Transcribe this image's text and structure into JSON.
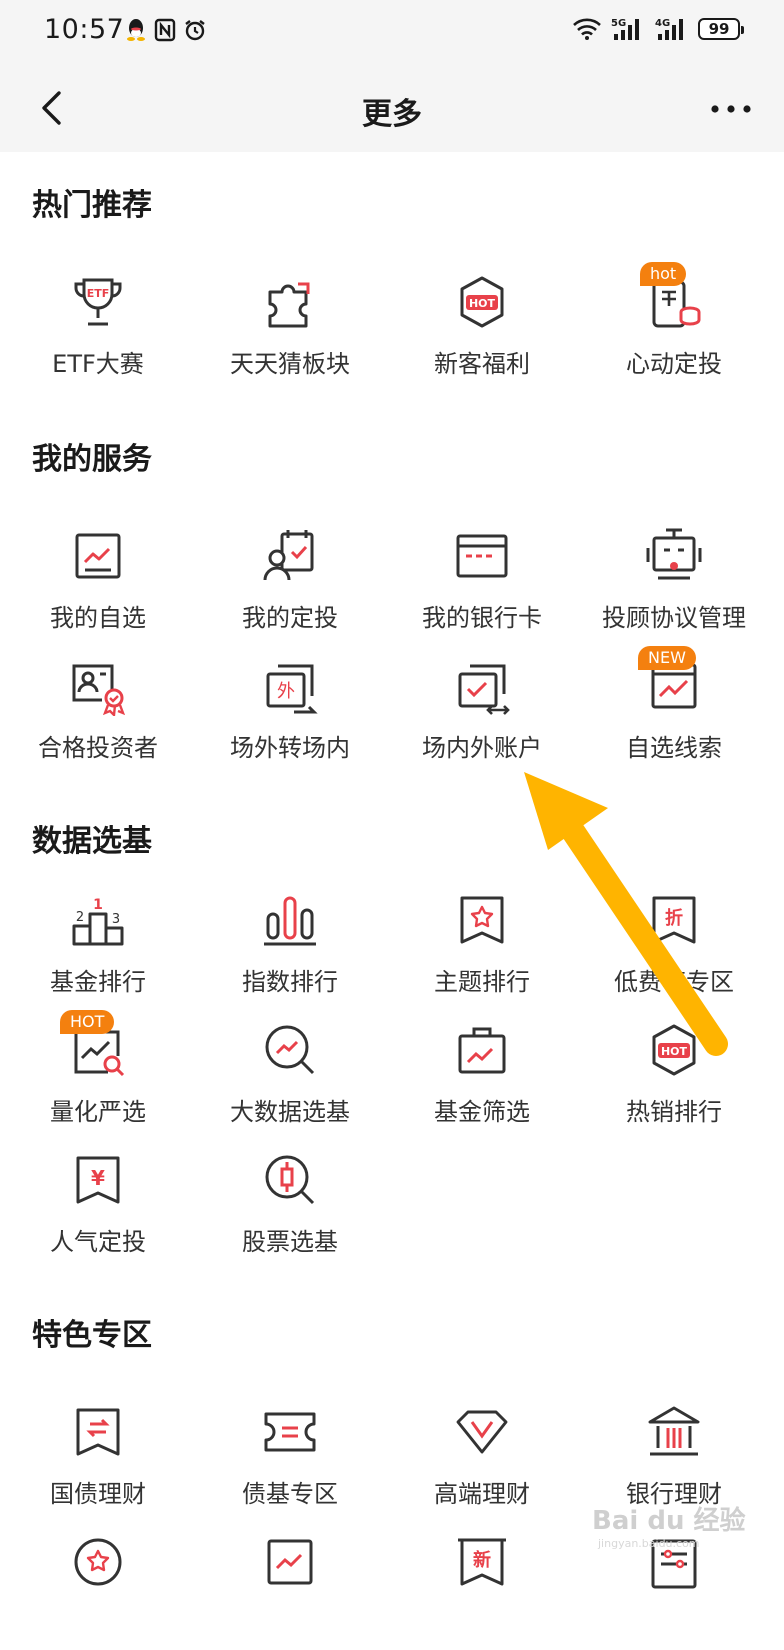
{
  "status_bar": {
    "time": "10:57",
    "battery": "99",
    "network_labels": [
      "5G",
      "4G"
    ]
  },
  "header": {
    "title": "更多"
  },
  "sections": [
    {
      "title": "热门推荐",
      "items": [
        {
          "label": "ETF大赛",
          "icon": "trophy-etf-icon",
          "icon_text": "ETF"
        },
        {
          "label": "天天猜板块",
          "icon": "puzzle-icon"
        },
        {
          "label": "新客福利",
          "icon": "hot-hexagon-icon",
          "icon_text": "HOT"
        },
        {
          "label": "心动定投",
          "icon": "phone-coin-icon",
          "badge": "hot"
        }
      ]
    },
    {
      "title": "我的服务",
      "items": [
        {
          "label": "我的自选",
          "icon": "chart-board-icon"
        },
        {
          "label": "我的定投",
          "icon": "user-calendar-icon"
        },
        {
          "label": "我的银行卡",
          "icon": "bank-card-icon"
        },
        {
          "label": "投顾协议管理",
          "icon": "robot-icon"
        },
        {
          "label": "合格投资者",
          "icon": "id-card-badge-icon"
        },
        {
          "label": "场外转场内",
          "icon": "transfer-window-icon",
          "icon_text": "外"
        },
        {
          "label": "场内外账户",
          "icon": "account-swap-icon"
        },
        {
          "label": "自选线索",
          "icon": "clue-chart-icon",
          "badge": "NEW"
        }
      ]
    },
    {
      "title": "数据选基",
      "items": [
        {
          "label": "基金排行",
          "icon": "podium-icon"
        },
        {
          "label": "指数排行",
          "icon": "bar-columns-icon"
        },
        {
          "label": "主题排行",
          "icon": "star-flag-icon"
        },
        {
          "label": "低费率专区",
          "icon": "discount-flag-icon",
          "icon_text": "折"
        },
        {
          "label": "量化严选",
          "icon": "chart-search-icon",
          "badge": "HOT"
        },
        {
          "label": "大数据选基",
          "icon": "magnify-trend-icon"
        },
        {
          "label": "基金筛选",
          "icon": "briefcase-chart-icon"
        },
        {
          "label": "热销排行",
          "icon": "hot-hexagon-icon",
          "icon_text": "HOT"
        },
        {
          "label": "人气定投",
          "icon": "yen-flag-icon",
          "icon_text": "¥"
        },
        {
          "label": "股票选基",
          "icon": "magnify-candle-icon"
        }
      ]
    },
    {
      "title": "特色专区",
      "items": [
        {
          "label": "国债理财",
          "icon": "bond-flag-icon"
        },
        {
          "label": "债基专区",
          "icon": "ticket-icon"
        },
        {
          "label": "高端理财",
          "icon": "diamond-icon"
        },
        {
          "label": "银行理财",
          "icon": "bank-building-icon"
        },
        {
          "label": "",
          "icon": "star-circle-icon"
        },
        {
          "label": "",
          "icon": "trend-board-icon"
        },
        {
          "label": "",
          "icon": "new-flag-icon",
          "icon_text": "新"
        },
        {
          "label": "",
          "icon": "list-board-icon"
        }
      ]
    }
  ],
  "watermark": {
    "text": "Bai du 经验",
    "sub": "jingyan.baidu.com"
  },
  "colors": {
    "accent": "#e8414a",
    "icon_stroke": "#333333",
    "badge": "#f4800f",
    "arrow": "#ffb400",
    "header_bg": "#f5f5f5"
  }
}
